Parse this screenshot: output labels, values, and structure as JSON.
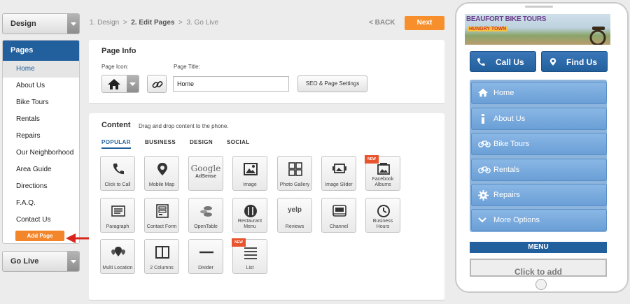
{
  "left_nav": {
    "design_dropdown": "Design",
    "pages_header": "Pages",
    "pages": [
      "Home",
      "About Us",
      "Bike Tours",
      "Rentals",
      "Repairs",
      "Our Neighborhood",
      "Area Guide",
      "Directions",
      "F.A.Q.",
      "Contact Us"
    ],
    "active_page": "Home",
    "add_page_label": "Add Page",
    "go_live_dropdown": "Go Live"
  },
  "steps": {
    "step1": "1. Design",
    "sep1": ">",
    "step2": "2. Edit Pages",
    "sep2": ">",
    "step3": "3. Go Live",
    "back_label": "< BACK",
    "next_label": "Next"
  },
  "page_info": {
    "title": "Page Info",
    "icon_label": "Page Icon:",
    "page_title_label": "Page Title:",
    "page_title_value": "Home",
    "seo_button": "SEO & Page Settings"
  },
  "content": {
    "title": "Content",
    "subtitle": "Drag and drop content to the phone.",
    "tabs": [
      "POPULAR",
      "BUSINESS",
      "DESIGN",
      "SOCIAL"
    ],
    "active_tab": "POPULAR",
    "tiles": [
      {
        "label": "Click to Call",
        "icon": "phone-icon"
      },
      {
        "label": "Mobile Map",
        "icon": "map-pin-icon"
      },
      {
        "label": "AdSense",
        "icon": "google-logo",
        "logo_text": "Google"
      },
      {
        "label": "Image",
        "icon": "image-icon"
      },
      {
        "label": "Photo Gallery",
        "icon": "gallery-icon"
      },
      {
        "label": "Image Slider",
        "icon": "slider-icon"
      },
      {
        "label": "Facebook Albums",
        "icon": "facebook-albums-icon",
        "badge": "NEW"
      },
      {
        "label": "Paragraph",
        "icon": "paragraph-icon"
      },
      {
        "label": "Contact Form",
        "icon": "form-icon"
      },
      {
        "label": "OpenTable",
        "icon": "opentable-icon"
      },
      {
        "label": "Restaurant Menu",
        "icon": "fork-knife-icon"
      },
      {
        "label": "Reviews",
        "icon": "yelp-logo",
        "logo_text": "yelp"
      },
      {
        "label": "Channel",
        "icon": "youtube-icon"
      },
      {
        "label": "Business Hours",
        "icon": "clock-icon"
      },
      {
        "label": "Multi Location",
        "icon": "multi-pin-icon"
      },
      {
        "label": "2 Columns",
        "icon": "columns-icon"
      },
      {
        "label": "Divider",
        "icon": "divider-icon"
      },
      {
        "label": "List",
        "icon": "list-icon",
        "badge": "NEW"
      }
    ]
  },
  "phone": {
    "banner_title": "BEAUFORT BIKE TOURS",
    "banner_subtitle": "HUNGRY TOWN",
    "call_button": "Call Us",
    "find_button": "Find Us",
    "menu_items": [
      {
        "label": "Home",
        "icon": "home-icon"
      },
      {
        "label": "About Us",
        "icon": "info-icon"
      },
      {
        "label": "Bike Tours",
        "icon": "bicycle-icon"
      },
      {
        "label": "Rentals",
        "icon": "bicycle-icon"
      },
      {
        "label": "Repairs",
        "icon": "gear-icon"
      },
      {
        "label": "More Options",
        "icon": "chevron-down-icon"
      }
    ],
    "menu_bar": "MENU",
    "click_to_add": "Click to add"
  },
  "colors": {
    "primary_blue": "#215f9d",
    "accent_orange": "#f7902c",
    "menu_item_blue": "#7aaede",
    "arrow_red": "#d9261c"
  }
}
